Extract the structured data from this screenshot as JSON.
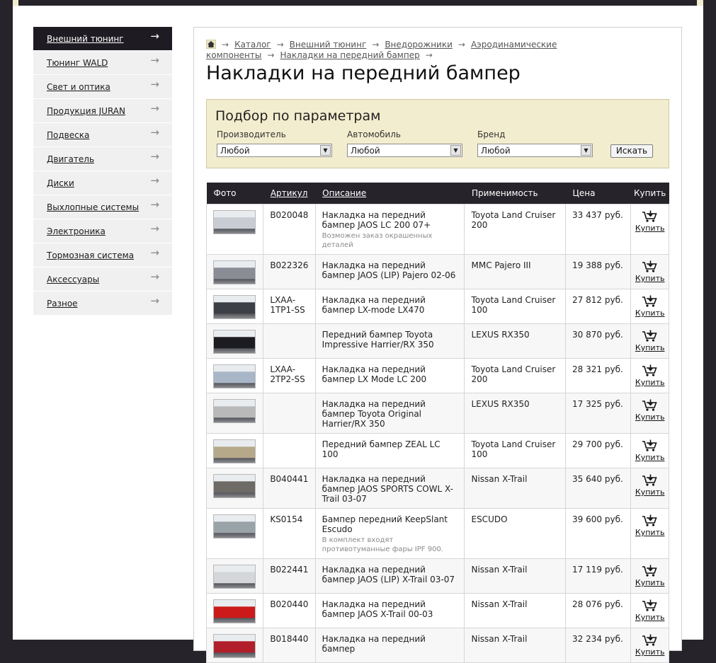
{
  "sidebar": {
    "items": [
      {
        "label": "Внешний тюнинг",
        "active": true
      },
      {
        "label": "Тюнинг WALD"
      },
      {
        "label": "Свет и оптика"
      },
      {
        "label": "Продукция JURAN"
      },
      {
        "label": "Подвеска"
      },
      {
        "label": "Двигатель"
      },
      {
        "label": "Диски"
      },
      {
        "label": "Выхлопные системы"
      },
      {
        "label": "Электроника"
      },
      {
        "label": "Тормозная система"
      },
      {
        "label": "Аксессуары"
      },
      {
        "label": "Разное"
      }
    ]
  },
  "breadcrumb": {
    "items": [
      "Каталог",
      "Внешний тюнинг",
      "Внедорожники",
      "Аэродинамические компоненты",
      "Накладки на передний бампер"
    ],
    "separator": "→"
  },
  "page_title": "Накладки на передний бампер",
  "filter": {
    "title": "Подбор по параметрам",
    "manufacturer_label": "Производитель",
    "manufacturer_value": "Любой",
    "car_label": "Автомобиль",
    "car_value": "Любой",
    "brand_label": "Бренд",
    "brand_value": "Любой",
    "search_label": "Искать"
  },
  "table": {
    "headers": {
      "photo": "Фото",
      "article": "Артикул",
      "description": "Описание",
      "applicability": "Применимость",
      "price": "Цена",
      "buy": "Купить"
    },
    "buy_label": "Купить",
    "rows": [
      {
        "article": "B020048",
        "desc": "Накладка на передний бампер JAOS LC 200 07+",
        "note": "Возможен заказ окрашенных деталей",
        "app": "Toyota Land Cruiser 200",
        "price": "33 437 руб.",
        "thumb_color": "#c9ccd2"
      },
      {
        "article": "B022326",
        "desc": "Накладка на передний бампер JAOS (LIP) Pajero 02-06",
        "note": "",
        "app": "MMC Pajero III",
        "price": "19 388 руб.",
        "thumb_color": "#8a8d95"
      },
      {
        "article": "LXAA-1TP1-SS",
        "desc": "Накладка на передний бампер LX-mode LX470",
        "note": "",
        "app": "Toyota Land Cruiser 100",
        "price": "27 812 руб.",
        "thumb_color": "#3c3f46"
      },
      {
        "article": "",
        "desc": "Передний бампер Toyota Impressive Harrier/RX 350",
        "note": "",
        "app": "LEXUS RX350",
        "price": "30 870 руб.",
        "thumb_color": "#1c1c20"
      },
      {
        "article": "LXAA-2TP2-SS",
        "desc": "Накладка на передний бампер LX Mode LC 200",
        "note": "",
        "app": "Toyota Land Cruiser 200",
        "price": "28 321 руб.",
        "thumb_color": "#a9b6c8"
      },
      {
        "article": "",
        "desc": "Накладка на передний бампер Toyota Original Harrier/RX 350",
        "note": "",
        "app": "LEXUS RX350",
        "price": "17 325 руб.",
        "thumb_color": "#b9b9b9"
      },
      {
        "article": "",
        "desc": "Передний бампер ZEAL LC 100",
        "note": "",
        "app": "Toyota Land Cruiser 100",
        "price": "29 700 руб.",
        "thumb_color": "#b5a98a"
      },
      {
        "article": "B040441",
        "desc": "Накладка на передний бампер JAOS SPORTS COWL X-Trail 03-07",
        "note": "",
        "app": "Nissan X-Trail",
        "price": "35 640 руб.",
        "thumb_color": "#6e6a66"
      },
      {
        "article": "KS0154",
        "desc": "Бампер передний KeepSlant Escudo",
        "note": "В комплект входят противотуманные фары IPF 900.",
        "app": "ESCUDO",
        "price": "39 600 руб.",
        "thumb_color": "#9aa3a8"
      },
      {
        "article": "B022441",
        "desc": "Накладка на передний бампер JAOS (LIP) X-Trail 03-07",
        "note": "",
        "app": "Nissan X-Trail",
        "price": "17 119 руб.",
        "thumb_color": "#d4d6d9"
      },
      {
        "article": "B020440",
        "desc": "Накладка на передний бампер JAOS X-Trail 00-03",
        "note": "",
        "app": "Nissan X-Trail",
        "price": "28 076 руб.",
        "thumb_color": "#cc1a1a"
      },
      {
        "article": "B018440",
        "desc": "Накладка на передний бампер",
        "note": "",
        "app": "Nissan X-Trail",
        "price": "32 234 руб.",
        "thumb_color": "#b11f2a"
      }
    ]
  }
}
